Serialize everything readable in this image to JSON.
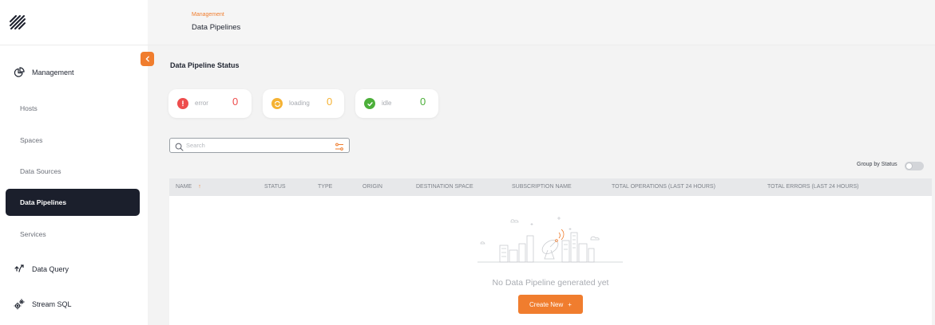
{
  "sidebar": {
    "sections": {
      "management": "Management",
      "data_query": "Data Query",
      "stream_sql": "Stream SQL"
    },
    "items": [
      {
        "label": "Hosts"
      },
      {
        "label": "Spaces"
      },
      {
        "label": "Data Sources"
      },
      {
        "label": "Data Pipelines",
        "active": true
      },
      {
        "label": "Services"
      }
    ]
  },
  "header": {
    "breadcrumb": "Management",
    "title": "Data Pipelines"
  },
  "main": {
    "section_title": "Data Pipeline Status",
    "status_cards": [
      {
        "label": "error",
        "count": "0",
        "color": "#ee4d4d"
      },
      {
        "label": "loading",
        "count": "0",
        "color": "#f5b233"
      },
      {
        "label": "idle",
        "count": "0",
        "color": "#4caf3a"
      }
    ],
    "search": {
      "placeholder": "Search",
      "value": ""
    },
    "group_by_status": {
      "label": "Group by Status",
      "enabled": false
    },
    "table": {
      "columns": [
        "NAME",
        "STATUS",
        "TYPE",
        "ORIGIN",
        "DESTINATION SPACE",
        "SUBSCRIPTION NAME",
        "TOTAL OPERATIONS (LAST 24 HOURS)",
        "TOTAL ERRORS (LAST 24 HOURS)"
      ],
      "rows": []
    },
    "empty_state": {
      "message": "No Data Pipeline generated yet",
      "button_label": "Create New",
      "button_suffix": "+"
    }
  },
  "colors": {
    "accent": "#f07d2e",
    "sidebar_active": "#1b1f2c"
  }
}
